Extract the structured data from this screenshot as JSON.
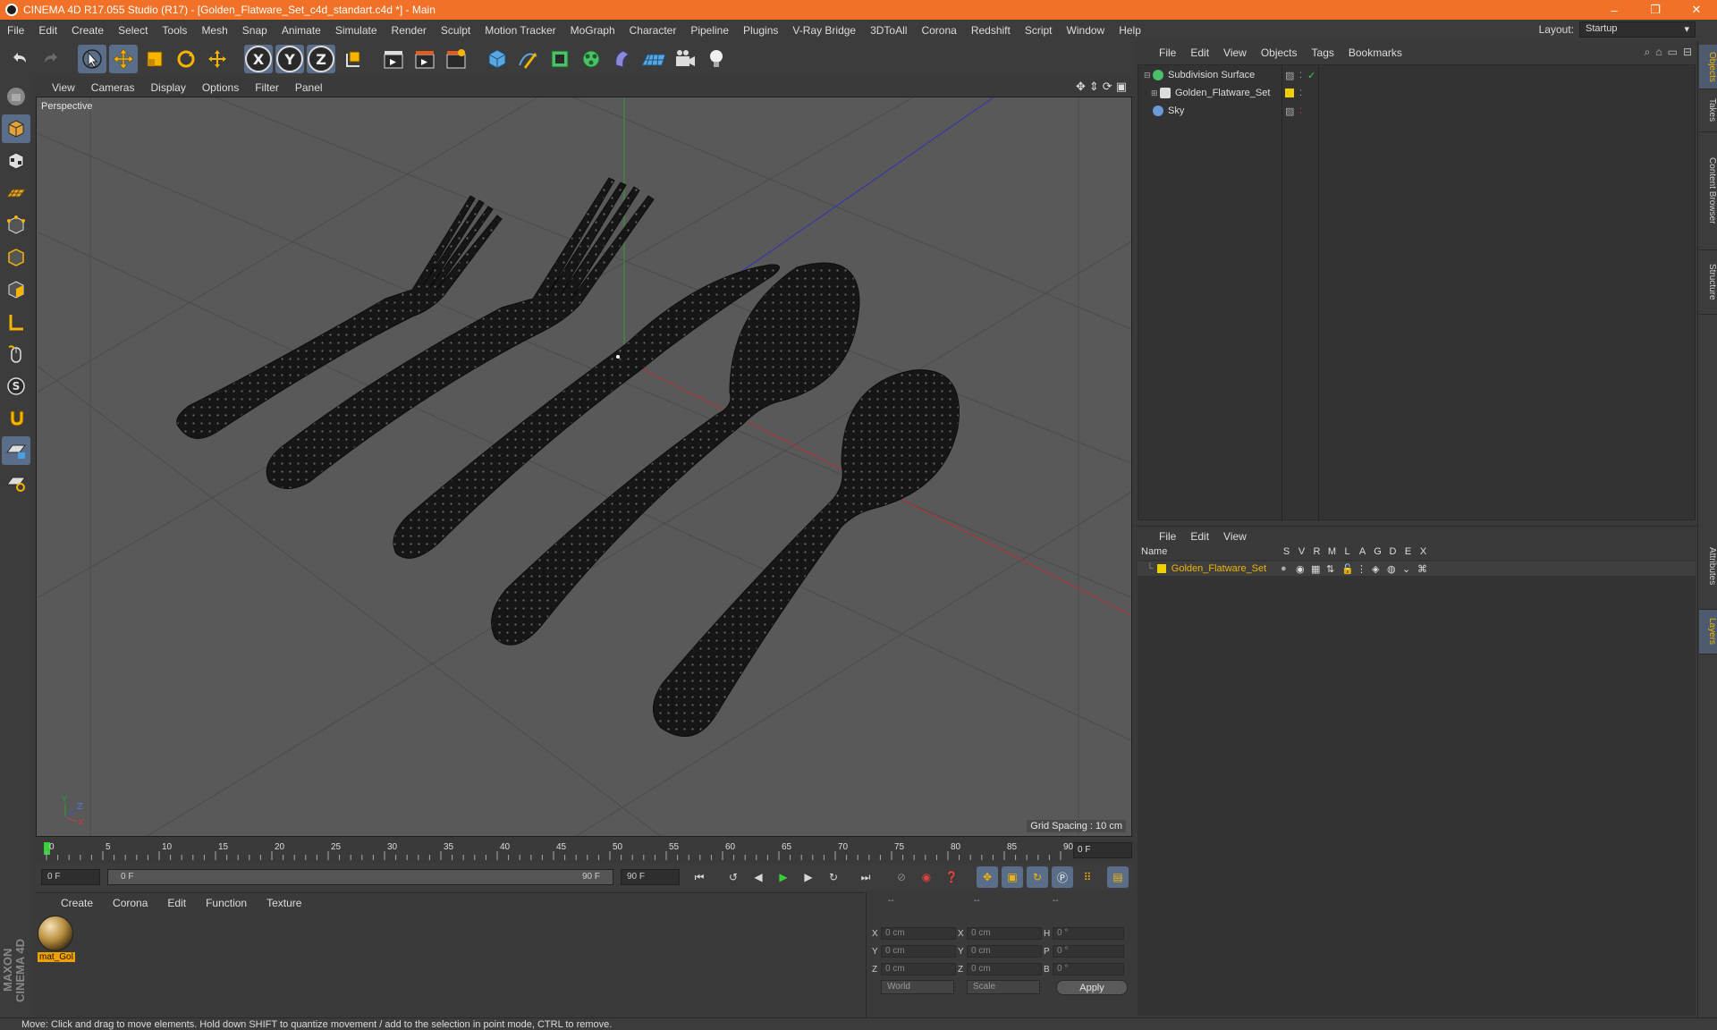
{
  "titlebar": {
    "title": "CINEMA 4D R17.055 Studio (R17) - [Golden_Flatware_Set_c4d_standart.c4d *] - Main",
    "minimize": "–",
    "restore": "❐",
    "close": "✕"
  },
  "menubar": {
    "items": [
      "File",
      "Edit",
      "Create",
      "Select",
      "Tools",
      "Mesh",
      "Snap",
      "Animate",
      "Simulate",
      "Render",
      "Sculpt",
      "Motion Tracker",
      "MoGraph",
      "Character",
      "Pipeline",
      "Plugins",
      "V-Ray Bridge",
      "3DToAll",
      "Corona",
      "Redshift",
      "Script",
      "Window",
      "Help"
    ],
    "layout_label": "Layout:",
    "layout_value": "Startup"
  },
  "toolbar": {
    "axis_x": "X",
    "axis_y": "Y",
    "axis_z": "Z"
  },
  "viewport": {
    "menu": [
      "View",
      "Cameras",
      "Display",
      "Options",
      "Filter",
      "Panel"
    ],
    "camera_label": "Perspective",
    "grid_spacing": "Grid Spacing : 10 cm",
    "axis_y": "Y",
    "axis_z": "Z",
    "axis_x": "X"
  },
  "timeline": {
    "ticks": [
      "0",
      "5",
      "10",
      "15",
      "20",
      "25",
      "30",
      "35",
      "40",
      "45",
      "50",
      "55",
      "60",
      "65",
      "70",
      "75",
      "80",
      "85",
      "90"
    ],
    "current_frame": "0 F"
  },
  "playback": {
    "start_field": "0 F",
    "range_start": "0 F",
    "range_end": "90 F",
    "end_field": "90 F"
  },
  "materials": {
    "menu": [
      "Create",
      "Corona",
      "Edit",
      "Function",
      "Texture"
    ],
    "items": [
      {
        "label": "mat_Gol"
      }
    ]
  },
  "coordinates": {
    "header": [
      "--",
      "--",
      "--"
    ],
    "rows": [
      {
        "a": "X",
        "a_val": "0 cm",
        "b": "X",
        "b_val": "0 cm",
        "c": "H",
        "c_val": "0 °"
      },
      {
        "a": "Y",
        "a_val": "0 cm",
        "b": "Y",
        "b_val": "0 cm",
        "c": "P",
        "c_val": "0 °"
      },
      {
        "a": "Z",
        "a_val": "0 cm",
        "b": "Z",
        "b_val": "0 cm",
        "c": "B",
        "c_val": "0 °"
      }
    ],
    "space_select": "World",
    "mode_select": "Scale",
    "apply": "Apply"
  },
  "status": {
    "text": "Move: Click and drag to move elements. Hold down SHIFT to quantize movement / add to the selection in point mode, CTRL to remove."
  },
  "object_manager": {
    "menu": [
      "File",
      "Edit",
      "View",
      "Objects",
      "Tags",
      "Bookmarks"
    ],
    "objects": [
      {
        "name": "Subdivision Surface"
      },
      {
        "name": "Golden_Flatware_Set"
      },
      {
        "name": "Sky"
      }
    ]
  },
  "layer_manager": {
    "menu": [
      "File",
      "Edit",
      "View"
    ],
    "columns": [
      "Name",
      "S",
      "V",
      "R",
      "M",
      "L",
      "A",
      "G",
      "D",
      "E",
      "X"
    ],
    "layers": [
      {
        "name": "Golden_Flatware_Set"
      }
    ]
  },
  "right_tabs": [
    "Objects",
    "Takes",
    "Content Browser",
    "Structure",
    "Attributes",
    "Layers"
  ],
  "brand": "MAXON CINEMA 4D",
  "colors": {
    "titlebar": "#f07127",
    "layer_name": "#f0b400",
    "active_tool": "#5a6e8a"
  }
}
